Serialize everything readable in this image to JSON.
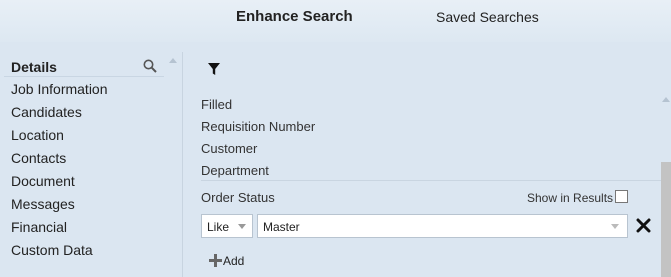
{
  "tabs": {
    "enhance": "Enhance Search",
    "saved": "Saved Searches"
  },
  "left": {
    "header": "Details",
    "items": [
      "Job Information",
      "Candidates",
      "Location",
      "Contacts",
      "Document",
      "Messages",
      "Financial",
      "Custom Data"
    ]
  },
  "right": {
    "fields": [
      "Filled",
      "Requisition Number",
      "Customer",
      "Department"
    ],
    "criterion": {
      "field": "Order Status",
      "show_in_results": "Show in Results",
      "show_checked": false,
      "operator": "Like",
      "value": "Master"
    },
    "add_label": "Add"
  },
  "icons": {
    "search": "search-icon",
    "filter": "filter-icon",
    "remove": "close-icon",
    "add": "plus-icon"
  }
}
